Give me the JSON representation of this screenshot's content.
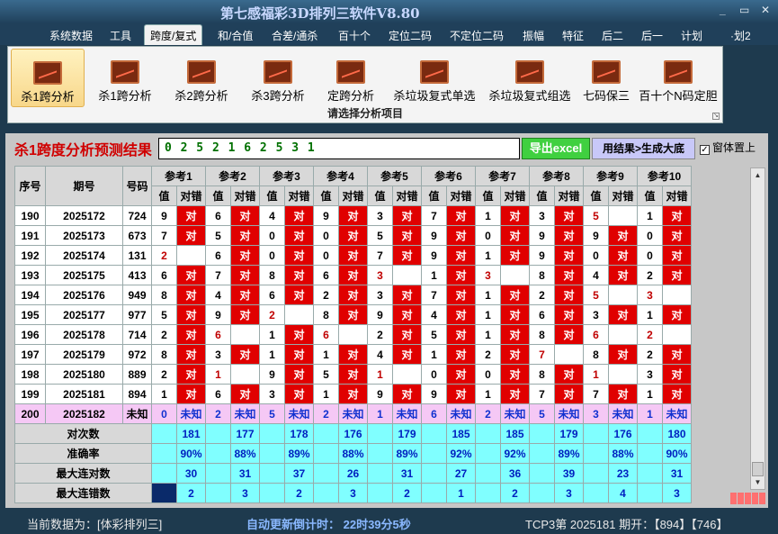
{
  "app": {
    "title": "第七感福彩3D排列三软件V8.80"
  },
  "window_buttons": {
    "minimize": "_",
    "restore": "▭",
    "close": "✕"
  },
  "menu": [
    "系统数据",
    "工具",
    "跨度/复式",
    "和/合值",
    "合差/通杀",
    "百十个",
    "定位二码",
    "不定位二码",
    "振幅",
    "特征",
    "后二",
    "后一",
    "计划",
    "·划2"
  ],
  "ribbon": {
    "buttons": [
      "杀1跨分析",
      "杀1跨分析",
      "杀2跨分析",
      "杀3跨分析",
      "定跨分析",
      "杀垃圾复式单选",
      "杀垃圾复式组选",
      "七码保三",
      "百十个N码定胆"
    ],
    "caption": "请选择分析项目",
    "icon": "chart-icon"
  },
  "panel": {
    "title": "杀1跨度分析预测结果",
    "result": "0 2 5 2 1 6 2 5 3 1",
    "export_label": "导出excel",
    "generate_label": "用结果>生成大底",
    "topmost_label": "窗体置上",
    "topmost_checked": true
  },
  "table": {
    "headers": {
      "seq": "序号",
      "period": "期号",
      "number": "号码",
      "val": "值",
      "check": "对错"
    },
    "groups": [
      "参考1",
      "参考2",
      "参考3",
      "参考4",
      "参考5",
      "参考6",
      "参考7",
      "参考8",
      "参考9",
      "参考10"
    ],
    "rows": [
      {
        "seq": "190",
        "period": "2025172",
        "num": "724",
        "v": [
          "9",
          "6",
          "4",
          "9",
          "3",
          "7",
          "1",
          "3",
          "5",
          "1"
        ],
        "k": [
          "对",
          "对",
          "对",
          "对",
          "对",
          "对",
          "对",
          "对",
          "",
          "对"
        ]
      },
      {
        "seq": "191",
        "period": "2025173",
        "num": "673",
        "v": [
          "7",
          "5",
          "0",
          "0",
          "5",
          "9",
          "0",
          "9",
          "9",
          "0"
        ],
        "k": [
          "对",
          "对",
          "对",
          "对",
          "对",
          "对",
          "对",
          "对",
          "对",
          "对"
        ]
      },
      {
        "seq": "192",
        "period": "2025174",
        "num": "131",
        "v": [
          "2",
          "6",
          "0",
          "0",
          "7",
          "9",
          "1",
          "9",
          "0",
          "0"
        ],
        "k": [
          "",
          "对",
          "对",
          "对",
          "对",
          "对",
          "对",
          "对",
          "对",
          "对"
        ]
      },
      {
        "seq": "193",
        "period": "2025175",
        "num": "413",
        "v": [
          "6",
          "7",
          "8",
          "6",
          "3",
          "1",
          "3",
          "8",
          "4",
          "2"
        ],
        "k": [
          "对",
          "对",
          "对",
          "对",
          "",
          "对",
          "",
          "对",
          "对",
          "对"
        ]
      },
      {
        "seq": "194",
        "period": "2025176",
        "num": "949",
        "v": [
          "8",
          "4",
          "6",
          "2",
          "3",
          "7",
          "1",
          "2",
          "5",
          "3"
        ],
        "k": [
          "对",
          "对",
          "对",
          "对",
          "对",
          "对",
          "对",
          "对",
          "",
          ""
        ]
      },
      {
        "seq": "195",
        "period": "2025177",
        "num": "977",
        "v": [
          "5",
          "9",
          "2",
          "8",
          "9",
          "4",
          "1",
          "6",
          "3",
          "1"
        ],
        "k": [
          "对",
          "对",
          "",
          "对",
          "对",
          "对",
          "对",
          "对",
          "对",
          "对"
        ]
      },
      {
        "seq": "196",
        "period": "2025178",
        "num": "714",
        "v": [
          "2",
          "6",
          "1",
          "6",
          "2",
          "5",
          "1",
          "8",
          "6",
          "2"
        ],
        "k": [
          "对",
          "",
          "对",
          "",
          "对",
          "对",
          "对",
          "对",
          "",
          ""
        ]
      },
      {
        "seq": "197",
        "period": "2025179",
        "num": "972",
        "v": [
          "8",
          "3",
          "1",
          "1",
          "4",
          "1",
          "2",
          "7",
          "8",
          "2"
        ],
        "k": [
          "对",
          "对",
          "对",
          "对",
          "对",
          "对",
          "对",
          "",
          "对",
          "对"
        ]
      },
      {
        "seq": "198",
        "period": "2025180",
        "num": "889",
        "v": [
          "2",
          "1",
          "9",
          "5",
          "1",
          "0",
          "0",
          "8",
          "1",
          "3"
        ],
        "k": [
          "对",
          "",
          "对",
          "对",
          "",
          "对",
          "对",
          "对",
          "",
          "对"
        ]
      },
      {
        "seq": "199",
        "period": "2025181",
        "num": "894",
        "v": [
          "1",
          "6",
          "3",
          "1",
          "9",
          "9",
          "1",
          "7",
          "7",
          "1"
        ],
        "k": [
          "对",
          "对",
          "对",
          "对",
          "对",
          "对",
          "对",
          "对",
          "对",
          "对"
        ]
      },
      {
        "seq": "200",
        "period": "2025182",
        "num": "未知",
        "v": [
          "0",
          "2",
          "5",
          "2",
          "1",
          "6",
          "2",
          "5",
          "3",
          "1"
        ],
        "k": [
          "未知",
          "未知",
          "未知",
          "未知",
          "未知",
          "未知",
          "未知",
          "未知",
          "未知",
          "未知"
        ]
      }
    ],
    "summary": [
      {
        "label": "对次数",
        "values": [
          "181",
          "177",
          "178",
          "176",
          "179",
          "185",
          "185",
          "179",
          "176",
          "180"
        ]
      },
      {
        "label": "准确率",
        "values": [
          "90%",
          "88%",
          "89%",
          "88%",
          "89%",
          "92%",
          "92%",
          "89%",
          "88%",
          "90%"
        ]
      },
      {
        "label": "最大连对数",
        "values": [
          "30",
          "31",
          "37",
          "26",
          "31",
          "27",
          "36",
          "39",
          "23",
          "31"
        ]
      },
      {
        "label": "最大连错数",
        "values": [
          "2",
          "3",
          "2",
          "3",
          "2",
          "1",
          "2",
          "3",
          "4",
          "3"
        ]
      }
    ]
  },
  "status": {
    "current_data": "当前数据为：[体彩排列三]",
    "countdown": "自动更新倒计时：  22时39分5秒",
    "period_info": "TCP3第 2025181 期开：【894】【746】"
  },
  "colors": {
    "correct": "#e00000",
    "unknown": "#f5c8f5",
    "summary": "#80ffff",
    "excel": "#40d040",
    "generate": "#c8c8f8"
  }
}
